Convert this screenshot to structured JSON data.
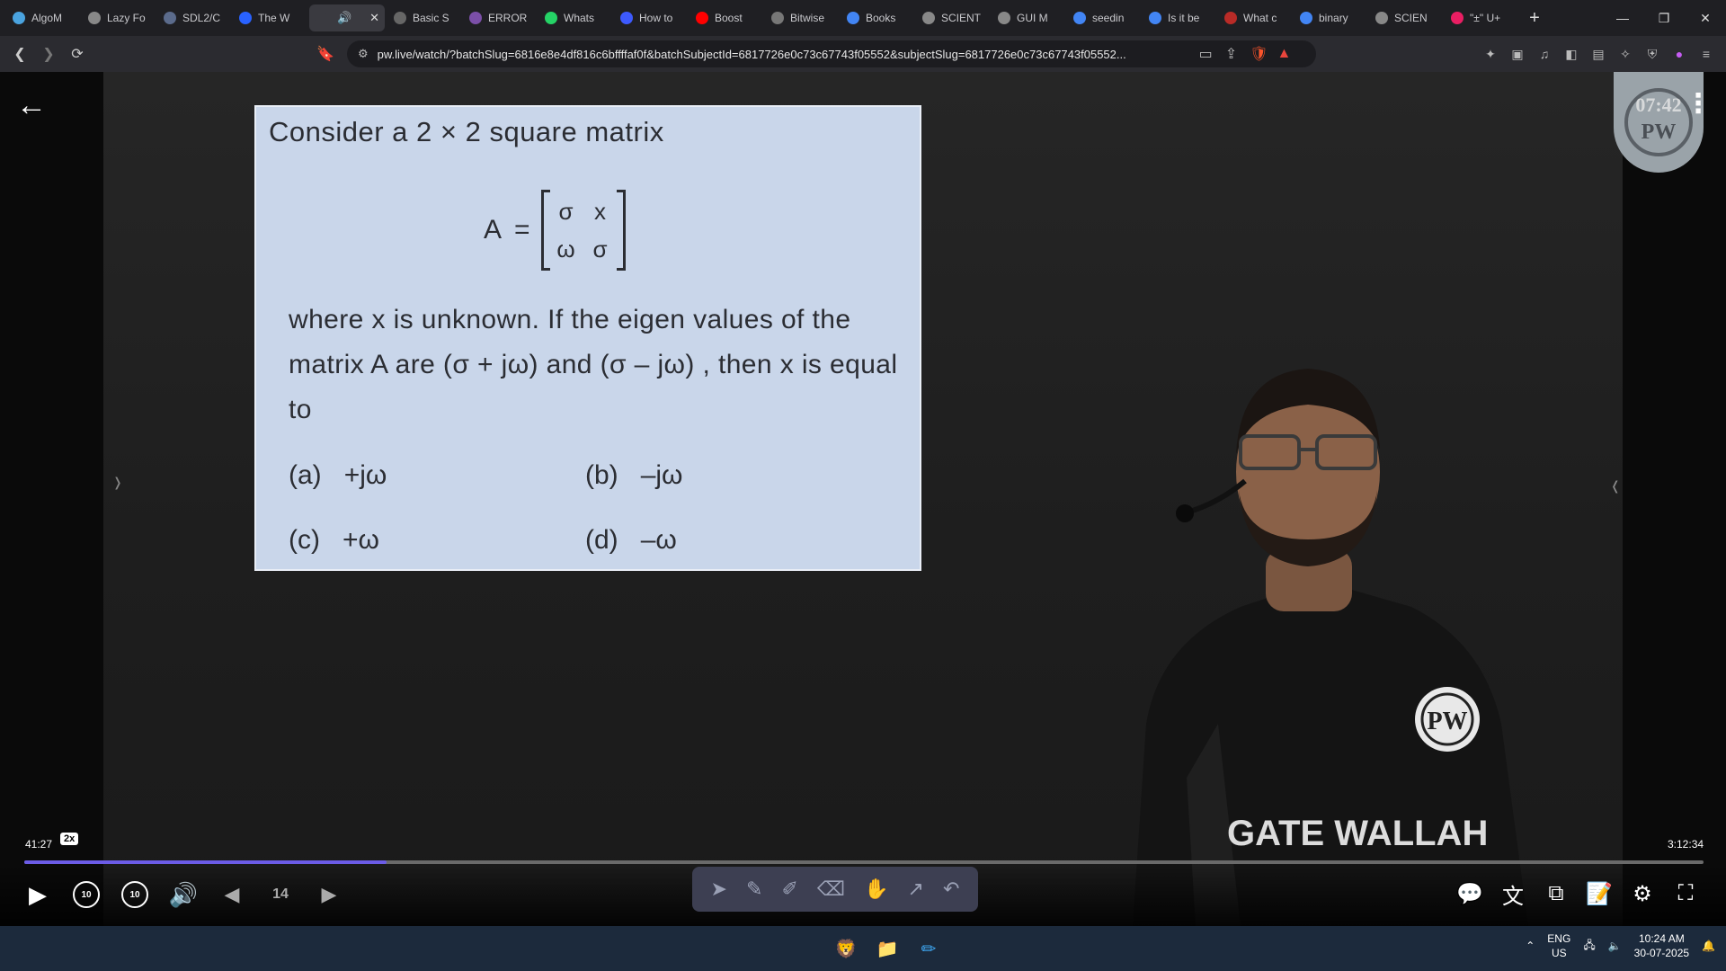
{
  "browser": {
    "tabs": [
      {
        "title": "AlgoM",
        "icon": "algo-icon",
        "color": "#4aa3df"
      },
      {
        "title": "Lazy Fo",
        "icon": "globe-icon",
        "color": "#888888"
      },
      {
        "title": "SDL2/C",
        "icon": "sdl-icon",
        "color": "#5b6b8c"
      },
      {
        "title": "The W",
        "icon": "w3-icon",
        "color": "#2962ff"
      },
      {
        "title": "",
        "icon": "speaker-icon",
        "color": "#3a3a40",
        "active": true
      },
      {
        "title": "Basic S",
        "icon": "page-icon",
        "color": "#666666"
      },
      {
        "title": "ERROR",
        "icon": "error-icon",
        "color": "#7b4fa8"
      },
      {
        "title": "Whats",
        "icon": "whatsapp-icon",
        "color": "#25d366"
      },
      {
        "title": "How to",
        "icon": "bookmark-icon",
        "color": "#3d5afe"
      },
      {
        "title": "Boost",
        "icon": "youtube-icon",
        "color": "#ff0000"
      },
      {
        "title": "Bitwise",
        "icon": "code-icon",
        "color": "#777777"
      },
      {
        "title": "Books",
        "icon": "google-icon",
        "color": "#4285f4"
      },
      {
        "title": "SCIENT",
        "icon": "globe-icon",
        "color": "#888888"
      },
      {
        "title": "GUI M",
        "icon": "gear-icon",
        "color": "#888888"
      },
      {
        "title": "seedin",
        "icon": "google-icon",
        "color": "#4285f4"
      },
      {
        "title": "Is it be",
        "icon": "google-icon",
        "color": "#4285f4"
      },
      {
        "title": "What c",
        "icon": "quora-icon",
        "color": "#b92b27"
      },
      {
        "title": "binary",
        "icon": "google-icon",
        "color": "#4285f4"
      },
      {
        "title": "SCIEN",
        "icon": "globe-icon",
        "color": "#888888"
      },
      {
        "title": "\"±\" U+",
        "icon": "dot-icon",
        "color": "#e91e63"
      }
    ],
    "new_tab": "+",
    "url": "pw.live/watch/?batchSlug=6816e8e4df816c6bffffaf0f&batchSubjectId=6817726e0c73c67743f05552&subjectSlug=6817726e0c73c67743f05552..."
  },
  "video": {
    "question": {
      "intro": "Consider a 2 × 2 square matrix",
      "matrix_label": "A",
      "matrix_eq": "=",
      "matrix": [
        "σ",
        "x",
        "ω",
        "σ"
      ],
      "body": "where x is unknown. If the eigen values of the matrix A are (σ + jω) and (σ – jω) , then x is equal to",
      "options": [
        {
          "label": "(a)",
          "value": "+jω"
        },
        {
          "label": "(b)",
          "value": "–jω"
        },
        {
          "label": "(c)",
          "value": "+ω"
        },
        {
          "label": "(d)",
          "value": "–ω"
        }
      ]
    },
    "logo_number": "07:42",
    "logo_text": "PW",
    "shirt_text": "GATE WALLAH",
    "current_time": "41:27",
    "speed": "2x",
    "total_time": "3:12:34",
    "progress_fraction": 0.2155,
    "buffered_fraction": 0.23,
    "skip_back": "10",
    "skip_forward": "10",
    "page_number": "14",
    "accent_color": "#6c5ce7"
  },
  "taskbar": {
    "lang_top": "ENG",
    "lang_bottom": "US",
    "time": "10:24 AM",
    "date": "30-07-2025"
  }
}
